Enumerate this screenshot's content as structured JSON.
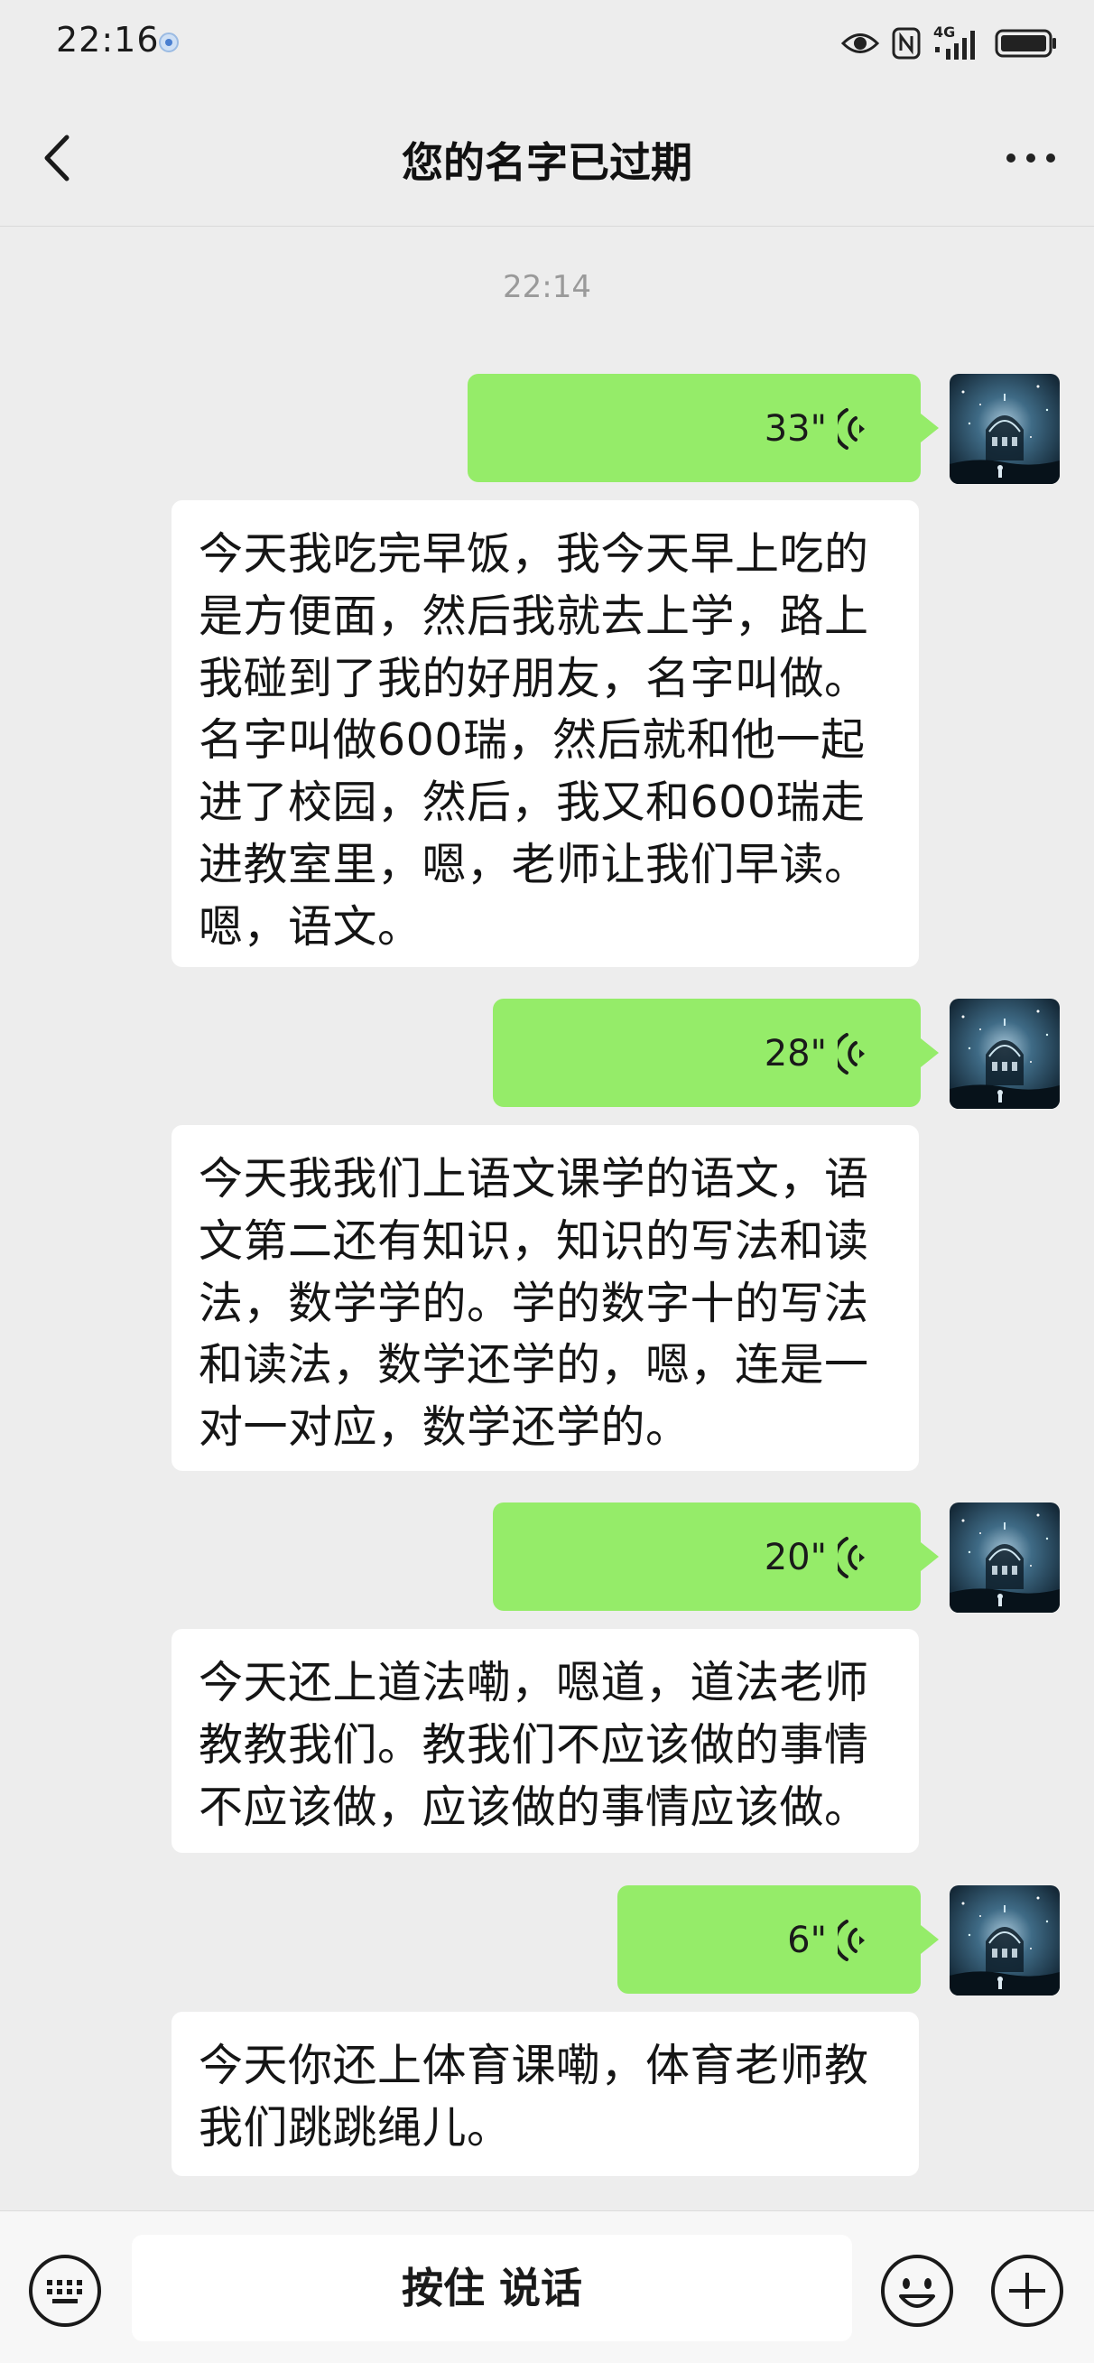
{
  "status_bar": {
    "time": "22:16",
    "network_label": "4G",
    "icons": [
      "location-dot-icon",
      "eye-icon",
      "nfc-icon",
      "signal-icon",
      "battery-icon"
    ]
  },
  "header": {
    "title": "您的名字已过期",
    "back_icon": "chevron-left-icon",
    "more_icon": "more-dots-icon"
  },
  "chat": {
    "timestamp": "22:14",
    "messages": [
      {
        "voice_duration": "33\"",
        "transcript": [
          "今天我吃完早饭，我今天早上吃的",
          "是方便面，然后我就去上学，路上",
          "我碰到了我的好朋友，名字叫做。",
          "名字叫做600瑞，然后就和他一起",
          "进了校园，然后，我又和600瑞走",
          "进教室里，嗯，老师让我们早读。",
          "嗯，语文。"
        ]
      },
      {
        "voice_duration": "28\"",
        "transcript": [
          "今天我我们上语文课学的语文，语",
          "文第二还有知识，知识的写法和读",
          "法，数学学的。学的数字十的写法",
          "和读法，数学还学的，嗯，连是一",
          "对一对应，数学还学的。"
        ]
      },
      {
        "voice_duration": "20\"",
        "transcript": [
          "今天还上道法嘞，嗯道，道法老师",
          "教教我们。教我们不应该做的事情",
          "不应该做，应该做的事情应该做。"
        ]
      },
      {
        "voice_duration": "6\"",
        "transcript": [
          "今天你还上体育课嘞，体育老师教",
          "我们跳跳绳儿。"
        ]
      }
    ]
  },
  "input_bar": {
    "hold_to_talk_label": "按住 说话",
    "keyboard_icon": "keyboard-icon",
    "emoji_icon": "emoji-icon",
    "plus_icon": "plus-icon"
  },
  "colors": {
    "background": "#ededed",
    "voice_bubble": "#95ec69",
    "transcript_bubble": "#ffffff"
  }
}
